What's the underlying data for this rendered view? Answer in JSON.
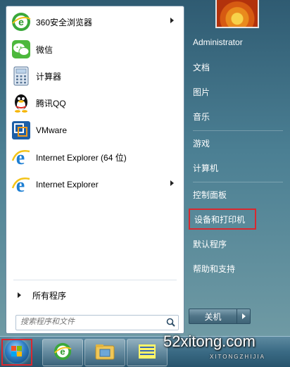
{
  "left_panel": {
    "pinned": [
      {
        "label": "360安全浏览器",
        "icon": "360-browser-icon",
        "has_submenu": true
      },
      {
        "label": "微信",
        "icon": "wechat-icon",
        "has_submenu": false
      },
      {
        "label": "计算器",
        "icon": "calculator-icon",
        "has_submenu": false
      },
      {
        "label": "腾讯QQ",
        "icon": "qq-penguin-icon",
        "has_submenu": false
      },
      {
        "label": "VMware",
        "icon": "vmware-icon",
        "has_submenu": false
      },
      {
        "label": "Internet Explorer (64 位)",
        "icon": "internet-explorer-icon",
        "has_submenu": false
      },
      {
        "label": "Internet Explorer",
        "icon": "internet-explorer-icon",
        "has_submenu": true
      }
    ],
    "all_programs": "所有程序",
    "search": {
      "placeholder": "搜索程序和文件",
      "icon": "search-icon"
    }
  },
  "right_panel": {
    "user": "Administrator",
    "items": [
      {
        "label": "文档"
      },
      {
        "label": "图片"
      },
      {
        "label": "音乐"
      },
      {
        "label": "游戏"
      },
      {
        "label": "计算机"
      },
      {
        "label": "控制面板"
      },
      {
        "label": "设备和打印机",
        "highlighted": true
      },
      {
        "label": "默认程序"
      },
      {
        "label": "帮助和支持"
      }
    ],
    "shutdown_label": "关机",
    "highlight_color": "#d9282f"
  },
  "taskbar": {
    "start_button": "windows-orb-icon",
    "pinned": [
      "360-browser-icon",
      "file-explorer-icon",
      "notepad-icon"
    ]
  },
  "watermark": {
    "text": "52xitong.com",
    "sub": "XITONGZHIJIA"
  }
}
